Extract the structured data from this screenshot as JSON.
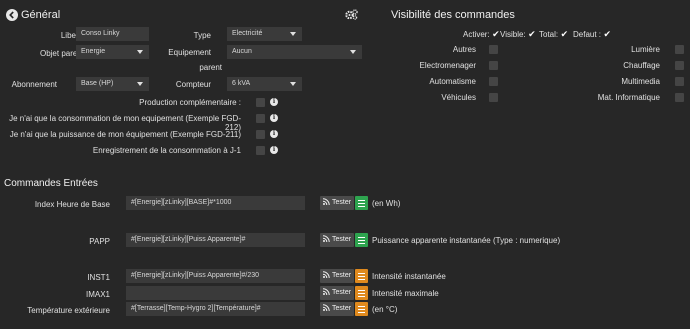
{
  "general": {
    "title": "Général",
    "fields": {
      "libelle": {
        "label": "Libelle",
        "value": "Conso Linky"
      },
      "type": {
        "label": "Type",
        "value": "Electricité"
      },
      "objet_parent": {
        "label": "Objet parent",
        "value": "Energie"
      },
      "equipement_parent": {
        "label_line1": "Equipement",
        "label_line2": "parent",
        "value": "Aucun"
      },
      "abonnement": {
        "label": "Abonnement",
        "value": "Base (HP)"
      },
      "compteur": {
        "label": "Compteur",
        "value": "6 kVA"
      }
    },
    "options": [
      {
        "label": "Production complémentaire :",
        "checked": false
      },
      {
        "label": "Je n'ai que la consommation de mon equipement (Exemple FGD-212)",
        "checked": false
      },
      {
        "label": "Je n'ai que la puissance de mon équipement (Exemple FGD-211)",
        "checked": false
      },
      {
        "label": "Enregistrement de la consommation à J-1",
        "checked": false
      }
    ]
  },
  "visibilite": {
    "title": "Visibilité des commandes",
    "header": {
      "activer": "Activer:",
      "visible": "Visible:",
      "total": "Total:",
      "defaut": "Defaut :"
    },
    "left_items": [
      "Autres",
      "Electromenager",
      "Automatisme",
      "Véhicules"
    ],
    "right_items": [
      "Lumière",
      "Chauffage",
      "Multimedia",
      "Mat. Informatique"
    ]
  },
  "commandes": {
    "title": "Commandes Entrées",
    "test_label": "Tester",
    "rows": [
      {
        "label": "Index Heure de Base",
        "value": "#[Energie][zLinky][BASE]#*1000",
        "color": "#2ea44f",
        "desc": "(en Wh)"
      },
      {
        "label": "PAPP",
        "value": "#[Energie][zLinky][Puiss Apparente]#",
        "color": "#2ea44f",
        "desc": "Puissance apparente instantanée (Type : numerique)"
      },
      {
        "label": "INST1",
        "value": "#[Energie][zLinky][Puiss Apparente]#/230",
        "color": "#e08a1e",
        "desc": "Intensité instantanée"
      },
      {
        "label": "IMAX1",
        "value": "",
        "color": "#e08a1e",
        "desc": "Intensité maximale"
      },
      {
        "label": "Température extérieure",
        "value": "#[Terrasse][Temp-Hygro 2][Température]#",
        "color": "#e08a1e",
        "desc": "(en °C)"
      }
    ]
  },
  "icons": {
    "back": "chevron-circle-left-icon",
    "config": "cogs-icon",
    "info": "info-circle-icon",
    "check": "check-icon",
    "test": "rss-icon",
    "list": "list-icon"
  }
}
